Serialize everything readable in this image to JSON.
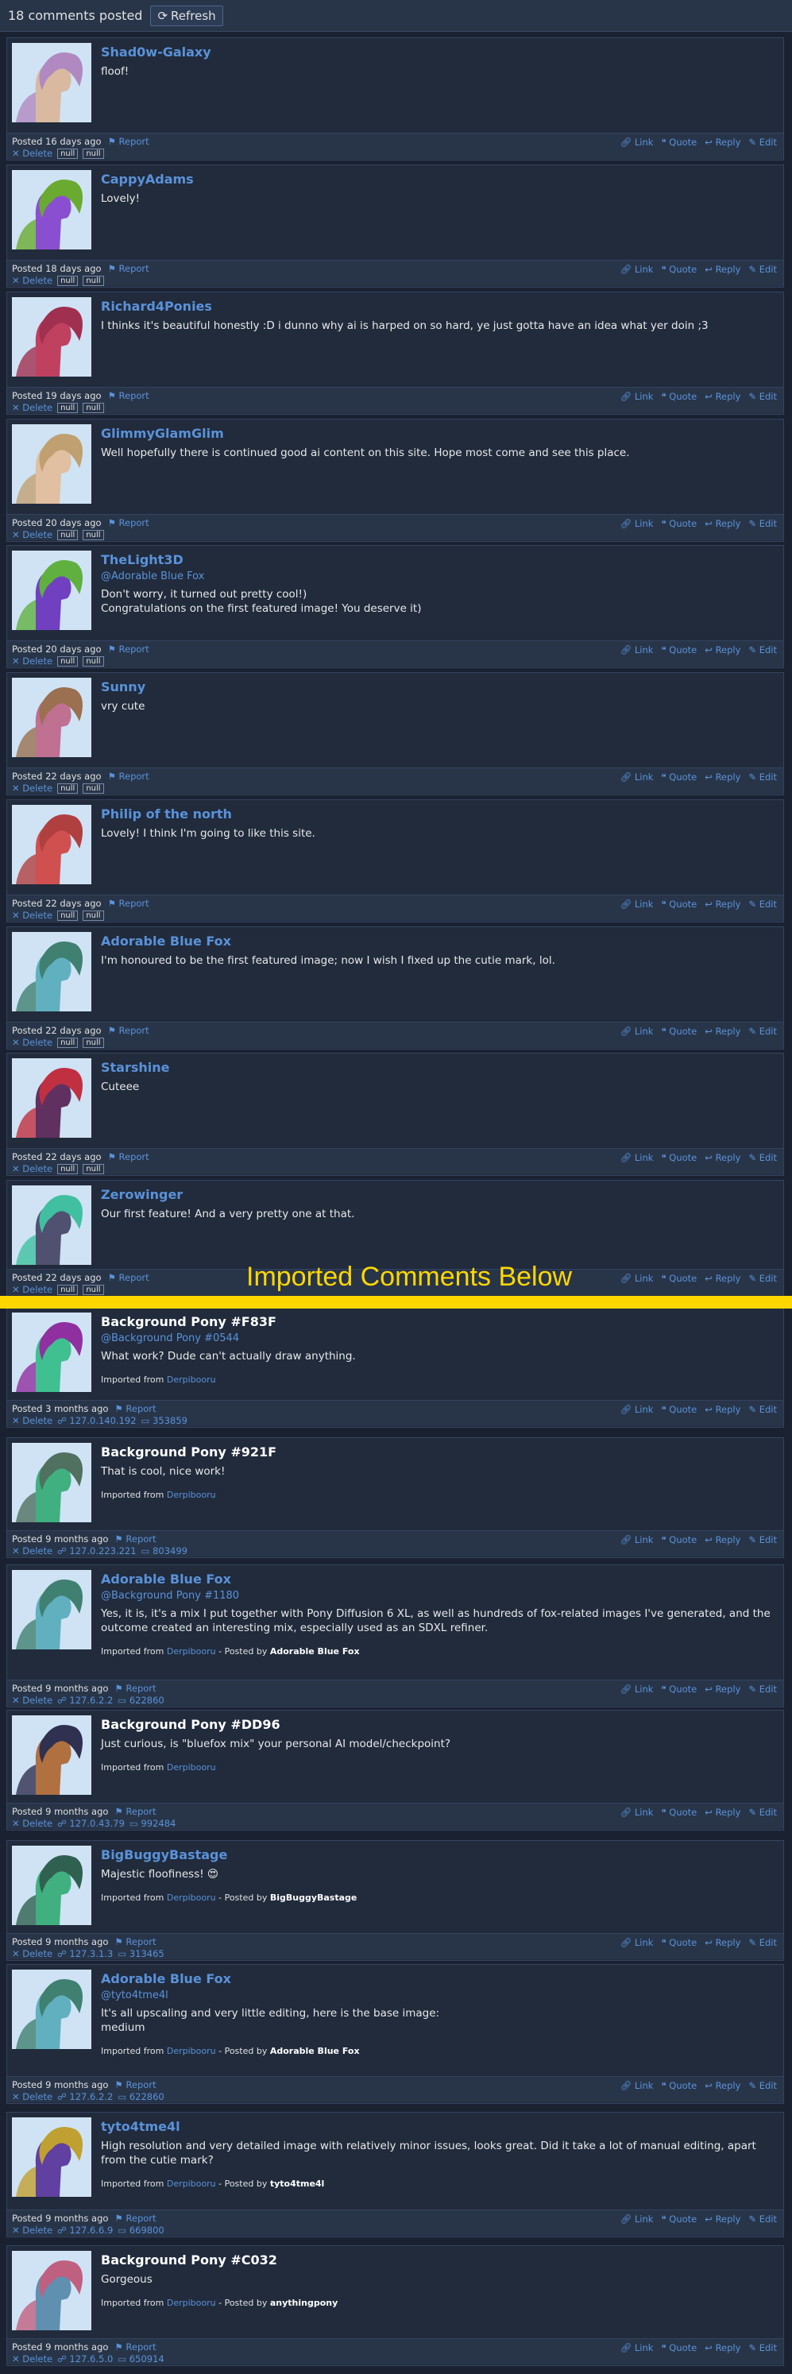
{
  "header": {
    "count_text": "18 comments posted",
    "refresh_label": "Refresh"
  },
  "separator_text": "Imported Comments Below",
  "actions": {
    "link": "Link",
    "quote": "Quote",
    "reply": "Reply",
    "edit": "Edit",
    "report": "Report",
    "delete": "Delete"
  },
  "colors": {
    "accent": "#5a92d9",
    "separator": "#ffd700",
    "background": "#1a2232"
  },
  "comments": [
    {
      "author": "Shad0w-Galaxy",
      "mention": "",
      "text": "floof!",
      "posted": "Posted 16 days ago",
      "meta1": "null",
      "meta2": "null",
      "imported": "",
      "imported_by": "",
      "icon_kind": "null",
      "avatar": {
        "body": "#d9b9a0",
        "mane": "#b089c0"
      }
    },
    {
      "author": "CappyAdams",
      "mention": "",
      "text": "Lovely!",
      "posted": "Posted 18 days ago",
      "meta1": "null",
      "meta2": "null",
      "imported": "",
      "imported_by": "",
      "icon_kind": "null",
      "avatar": {
        "body": "#8a4fd0",
        "mane": "#6aaa30"
      }
    },
    {
      "author": "Richard4Ponies",
      "mention": "",
      "text": "I thinks it's beautiful honestly :D i dunno why ai is harped on so hard, ye just gotta have an idea what yer doin ;3",
      "posted": "Posted 19 days ago",
      "meta1": "null",
      "meta2": "null",
      "imported": "",
      "imported_by": "",
      "icon_kind": "null",
      "avatar": {
        "body": "#c04060",
        "mane": "#a03050"
      }
    },
    {
      "author": "GlimmyGlamGlim",
      "mention": "",
      "text": "Well hopefully there is continued good ai content on this site. Hope most come and see this place.",
      "posted": "Posted 20 days ago",
      "meta1": "null",
      "meta2": "null",
      "imported": "",
      "imported_by": "",
      "icon_kind": "null",
      "avatar": {
        "body": "#e0c0a0",
        "mane": "#c0a070"
      }
    },
    {
      "author": "TheLight3D",
      "mention": "@Adorable Blue Fox",
      "text": "Don't worry, it turned out pretty cool!)\nCongratulations on the first featured image! You deserve it)",
      "posted": "Posted 20 days ago",
      "meta1": "null",
      "meta2": "null",
      "imported": "",
      "imported_by": "",
      "icon_kind": "null",
      "avatar": {
        "body": "#7040c0",
        "mane": "#60b040"
      }
    },
    {
      "author": "Sunny",
      "mention": "",
      "text": "vry cute",
      "posted": "Posted 22 days ago",
      "meta1": "null",
      "meta2": "null",
      "imported": "",
      "imported_by": "",
      "icon_kind": "null",
      "avatar": {
        "body": "#c07090",
        "mane": "#9a7050"
      }
    },
    {
      "author": "Philip of the north",
      "mention": "",
      "text": "Lovely! I think I'm going to like this site.",
      "posted": "Posted 22 days ago",
      "meta1": "null",
      "meta2": "null",
      "imported": "",
      "imported_by": "",
      "icon_kind": "null",
      "avatar": {
        "body": "#d05050",
        "mane": "#b04040"
      }
    },
    {
      "author": "Adorable Blue Fox",
      "mention": "",
      "text": "I'm honoured to be the first featured image; now I wish I fixed up the cutie mark, lol.",
      "posted": "Posted 22 days ago",
      "meta1": "null",
      "meta2": "null",
      "imported": "",
      "imported_by": "",
      "icon_kind": "null",
      "avatar": {
        "body": "#60b0c0",
        "mane": "#408070"
      }
    },
    {
      "author": "Starshine",
      "mention": "",
      "text": "Cuteee",
      "posted": "Posted 22 days ago",
      "meta1": "null",
      "meta2": "null",
      "imported": "",
      "imported_by": "",
      "icon_kind": "null",
      "avatar": {
        "body": "#603060",
        "mane": "#c03040"
      }
    },
    {
      "author": "Zerowinger",
      "mention": "",
      "text": "Our first feature! And a very pretty one at that.",
      "posted": "Posted 22 days ago",
      "meta1": "null",
      "meta2": "null",
      "imported": "",
      "imported_by": "",
      "icon_kind": "null",
      "avatar": {
        "body": "#505070",
        "mane": "#40c0a0"
      }
    },
    {
      "author": "Background Pony #F83F",
      "mention": "@Background Pony #0544",
      "text": "What work? Dude can't actually draw anything.",
      "posted": "Posted 3 months ago",
      "meta1": "127.0.140.192",
      "meta2": "353859",
      "imported": "Derpibooru",
      "imported_by": "",
      "icon_kind": "ip",
      "avatar": {
        "body": "#40c090",
        "mane": "#9030a0"
      }
    },
    {
      "author": "Background Pony #921F",
      "mention": "",
      "text": "That is cool, nice work!",
      "posted": "Posted 9 months ago",
      "meta1": "127.0.223.221",
      "meta2": "803499",
      "imported": "Derpibooru",
      "imported_by": "",
      "icon_kind": "ip",
      "avatar": {
        "body": "#40b080",
        "mane": "#507060"
      }
    },
    {
      "author": "Adorable Blue Fox",
      "mention": "@Background Pony #1180",
      "text": "Yes, it is, it's a mix I put together with Pony Diffusion 6 XL, as well as hundreds of fox-related images I've generated, and the outcome created an interesting mix, especially used as an SDXL refiner.",
      "posted": "Posted 9 months ago",
      "meta1": "127.6.2.2",
      "meta2": "622860",
      "imported": "Derpibooru",
      "imported_by": "Adorable Blue Fox",
      "icon_kind": "ip",
      "avatar": {
        "body": "#60b0c0",
        "mane": "#408070"
      }
    },
    {
      "author": "Background Pony #DD96",
      "mention": "",
      "text": "Just curious, is \"bluefox mix\" your personal AI model/checkpoint?",
      "posted": "Posted 9 months ago",
      "meta1": "127.0.43.79",
      "meta2": "992484",
      "imported": "Derpibooru",
      "imported_by": "",
      "icon_kind": "ip",
      "avatar": {
        "body": "#b07040",
        "mane": "#303050"
      }
    },
    {
      "author": "BigBuggyBastage",
      "mention": "",
      "text": "Majestic floofiness! 😍",
      "posted": "Posted 9 months ago",
      "meta1": "127.3.1.3",
      "meta2": "313465",
      "imported": "Derpibooru",
      "imported_by": "BigBuggyBastage",
      "icon_kind": "ip",
      "avatar": {
        "body": "#40b080",
        "mane": "#306050"
      }
    },
    {
      "author": "Adorable Blue Fox",
      "mention": "@tyto4tme4l",
      "text": "It's all upscaling and very little editing, here is the base image:\nmedium",
      "posted": "Posted 9 months ago",
      "meta1": "127.6.2.2",
      "meta2": "622860",
      "imported": "Derpibooru",
      "imported_by": "Adorable Blue Fox",
      "icon_kind": "ip",
      "avatar": {
        "body": "#60b0c0",
        "mane": "#408070"
      }
    },
    {
      "author": "tyto4tme4l",
      "mention": "",
      "text": "High resolution and very detailed image with relatively minor issues, looks great. Did it take a lot of manual editing, apart from the cutie mark?",
      "posted": "Posted 9 months ago",
      "meta1": "127.6.6.9",
      "meta2": "669800",
      "imported": "Derpibooru",
      "imported_by": "tyto4tme4l",
      "icon_kind": "ip",
      "avatar": {
        "body": "#6040a0",
        "mane": "#c0a030"
      }
    },
    {
      "author": "Background Pony #C032",
      "mention": "",
      "text": "Gorgeous",
      "posted": "Posted 9 months ago",
      "meta1": "127.6.5.0",
      "meta2": "650914",
      "imported": "Derpibooru",
      "imported_by": "anythingpony",
      "icon_kind": "ip",
      "avatar": {
        "body": "#6090b0",
        "mane": "#c06080"
      }
    }
  ]
}
